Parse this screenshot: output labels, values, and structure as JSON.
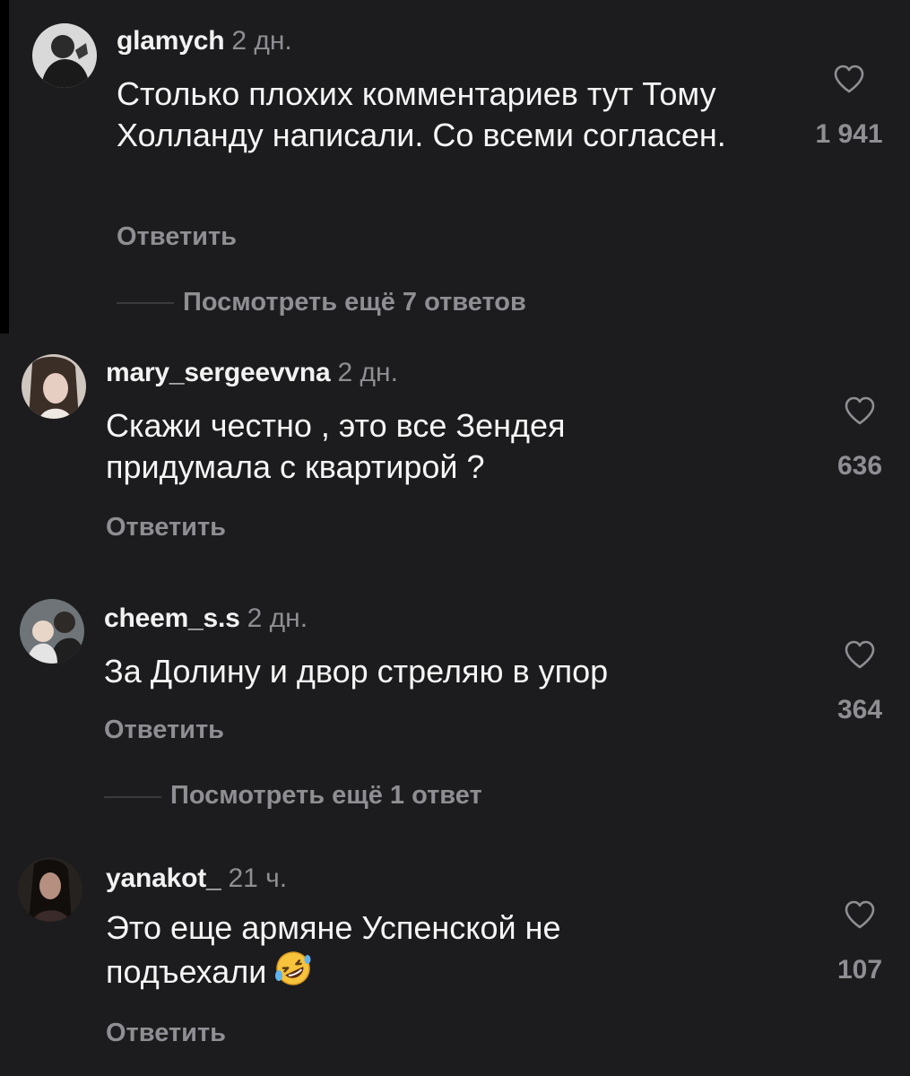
{
  "colors": {
    "background": "#1c1c1e",
    "text": "#f5f5f5",
    "muted": "#8e8e93"
  },
  "comments": [
    {
      "username": "glamych",
      "time": "2 дн.",
      "text": "Столько плохих комментариев тут Тому Холланду написали. Со всеми согласен.",
      "reply_label": "Ответить",
      "likes": "1 941",
      "icon": "heart-outline-icon",
      "more_replies": "Посмотреть ещё 7 ответов"
    },
    {
      "username": "mary_sergeevvna",
      "time": "2 дн.",
      "text": "Скажи честно , это все Зендея придумала с квартирой ?",
      "reply_label": "Ответить",
      "likes": "636",
      "icon": "heart-outline-icon"
    },
    {
      "username": "cheem_s.s",
      "time": "2 дн.",
      "text": "За Долину и двор стреляю в упор",
      "reply_label": "Ответить",
      "likes": "364",
      "icon": "heart-outline-icon",
      "more_replies": "Посмотреть ещё 1 ответ"
    },
    {
      "username": "yanakot_",
      "time": "21 ч.",
      "text": "Это еще армяне Успенской не подъехали",
      "emoji": "rolling-on-floor-laughing-emoji",
      "reply_label": "Ответить",
      "likes": "107",
      "icon": "heart-outline-icon"
    }
  ]
}
